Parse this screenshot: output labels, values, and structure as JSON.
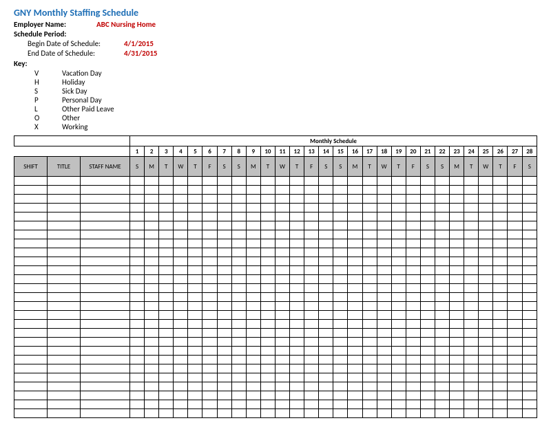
{
  "header": {
    "title": "GNY Monthly Staffing Schedule",
    "employer_label": "Employer Name:",
    "employer_value": "ABC Nursing Home",
    "period_label": "Schedule Period:",
    "begin_label": "Begin Date of Schedule:",
    "begin_value": "4/1/2015",
    "end_label": "End Date of Schedule:",
    "end_value": "4/31/2015"
  },
  "key": {
    "label": "Key:",
    "items": [
      {
        "code": "V",
        "desc": "Vacation Day"
      },
      {
        "code": "H",
        "desc": "Holiday"
      },
      {
        "code": "S",
        "desc": "Sick Day"
      },
      {
        "code": "P",
        "desc": "Personal Day"
      },
      {
        "code": "L",
        "desc": "Other Paid Leave"
      },
      {
        "code": "O",
        "desc": "Other"
      },
      {
        "code": "X",
        "desc": "Working"
      }
    ]
  },
  "table": {
    "title": "Monthly Schedule",
    "left_headers": [
      "SHIFT",
      "TITLE",
      "STAFF NAME"
    ],
    "days": [
      {
        "num": "1",
        "dow": "S"
      },
      {
        "num": "2",
        "dow": "M"
      },
      {
        "num": "3",
        "dow": "T"
      },
      {
        "num": "4",
        "dow": "W"
      },
      {
        "num": "5",
        "dow": "T"
      },
      {
        "num": "6",
        "dow": "F"
      },
      {
        "num": "7",
        "dow": "S"
      },
      {
        "num": "8",
        "dow": "S"
      },
      {
        "num": "9",
        "dow": "M"
      },
      {
        "num": "10",
        "dow": "T"
      },
      {
        "num": "11",
        "dow": "W"
      },
      {
        "num": "12",
        "dow": "T"
      },
      {
        "num": "13",
        "dow": "F"
      },
      {
        "num": "14",
        "dow": "S"
      },
      {
        "num": "15",
        "dow": "S"
      },
      {
        "num": "16",
        "dow": "M"
      },
      {
        "num": "17",
        "dow": "T"
      },
      {
        "num": "18",
        "dow": "W"
      },
      {
        "num": "19",
        "dow": "T"
      },
      {
        "num": "20",
        "dow": "F"
      },
      {
        "num": "21",
        "dow": "S"
      },
      {
        "num": "22",
        "dow": "S"
      },
      {
        "num": "23",
        "dow": "M"
      },
      {
        "num": "24",
        "dow": "T"
      },
      {
        "num": "25",
        "dow": "W"
      },
      {
        "num": "26",
        "dow": "T"
      },
      {
        "num": "27",
        "dow": "F"
      },
      {
        "num": "28",
        "dow": "S"
      }
    ],
    "row_count": 27
  }
}
